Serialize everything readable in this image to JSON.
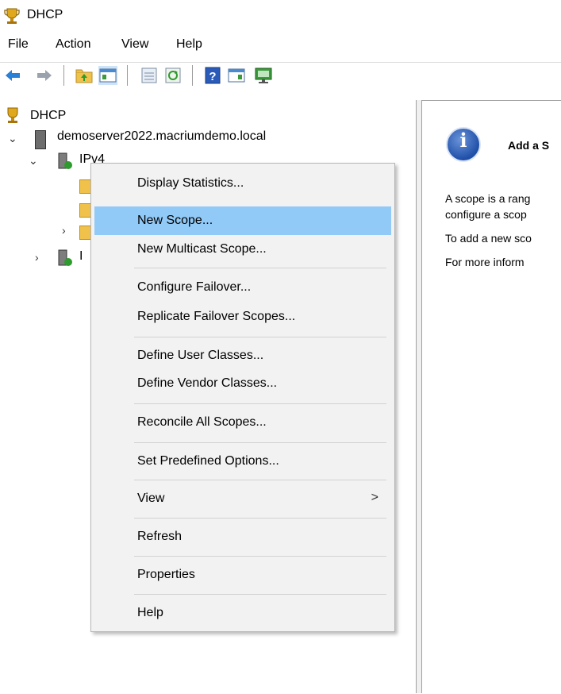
{
  "window": {
    "title": "DHCP"
  },
  "menu": [
    "File",
    "Action",
    "View",
    "Help"
  ],
  "toolbar": {
    "buttons": [
      "back-icon",
      "forward-icon",
      "up-folder-icon",
      "show-hide-console-tree-icon",
      "export-list-icon",
      "refresh-icon",
      "help-icon",
      "show-action-pane-icon",
      "monitor-icon"
    ]
  },
  "tree": {
    "root": "DHCP",
    "server": "demoserver2022.macriumdemo.local",
    "ipv4": "IPv4",
    "ipv6_partial": "I"
  },
  "context_menu": {
    "items": [
      {
        "label": "Display Statistics..."
      },
      {
        "label": "New Scope...",
        "highlighted": true
      },
      {
        "label": "New Multicast Scope..."
      },
      {
        "label": "Configure Failover..."
      },
      {
        "label": "Replicate Failover Scopes..."
      },
      {
        "label": "Define User Classes..."
      },
      {
        "label": "Define Vendor Classes..."
      },
      {
        "label": "Reconcile All Scopes..."
      },
      {
        "label": "Set Predefined Options..."
      },
      {
        "label": "View",
        "submenu": true
      },
      {
        "label": "Refresh"
      },
      {
        "label": "Properties"
      },
      {
        "label": "Help"
      }
    ],
    "submenu_arrow": ">"
  },
  "right_pane": {
    "heading": "Add a S",
    "line1": "A scope is a rang",
    "line2": "configure a scop",
    "line3": "To add a new sco",
    "line4": "For more inform"
  },
  "colors": {
    "highlight": "#91c9f7",
    "menu_bg": "#f2f2f2",
    "info_icon": "#1f4fa8"
  }
}
